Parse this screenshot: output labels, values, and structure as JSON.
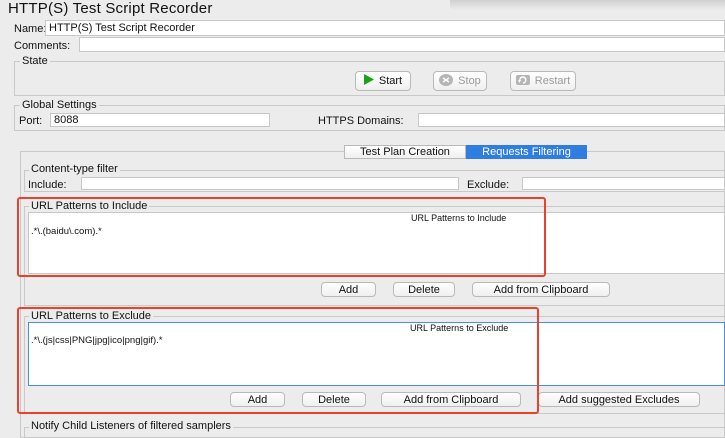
{
  "window": {
    "title": "HTTP(S) Test Script Recorder"
  },
  "name": {
    "label": "Name:",
    "value": "HTTP(S) Test Script Recorder"
  },
  "comments": {
    "label": "Comments:",
    "value": ""
  },
  "state": {
    "legend": "State",
    "start_label": "Start",
    "stop_label": "Stop",
    "restart_label": "Restart"
  },
  "global": {
    "legend": "Global Settings",
    "port_label": "Port:",
    "port_value": "8088",
    "https_label": "HTTPS Domains:",
    "https_value": ""
  },
  "tabs": [
    {
      "label": "Test Plan Creation",
      "selected": false
    },
    {
      "label": "Requests Filtering",
      "selected": true
    }
  ],
  "content_type": {
    "legend": "Content-type filter",
    "include_label": "Include:",
    "include_value": "",
    "exclude_label": "Exclude:",
    "exclude_value": ""
  },
  "include_patterns": {
    "legend": "URL Patterns to Include",
    "column_header": "URL Patterns to Include",
    "rows": [
      ".*\\.(baidu\\.com).*"
    ],
    "add_label": "Add",
    "delete_label": "Delete",
    "clipboard_label": "Add from Clipboard"
  },
  "exclude_patterns": {
    "legend": "URL Patterns to Exclude",
    "column_header": "URL Patterns to Exclude",
    "rows": [
      ".*\\.(js|css|PNG|jpg|ico|png|gif).*"
    ],
    "add_label": "Add",
    "delete_label": "Delete",
    "clipboard_label": "Add from Clipboard",
    "suggested_label": "Add suggested Excludes"
  },
  "notify": {
    "legend": "Notify Child Listeners of filtered samplers"
  },
  "colors": {
    "highlight": "#e8412c",
    "tab_selected": "#2f7de1",
    "start_green": "#1aa31a"
  }
}
